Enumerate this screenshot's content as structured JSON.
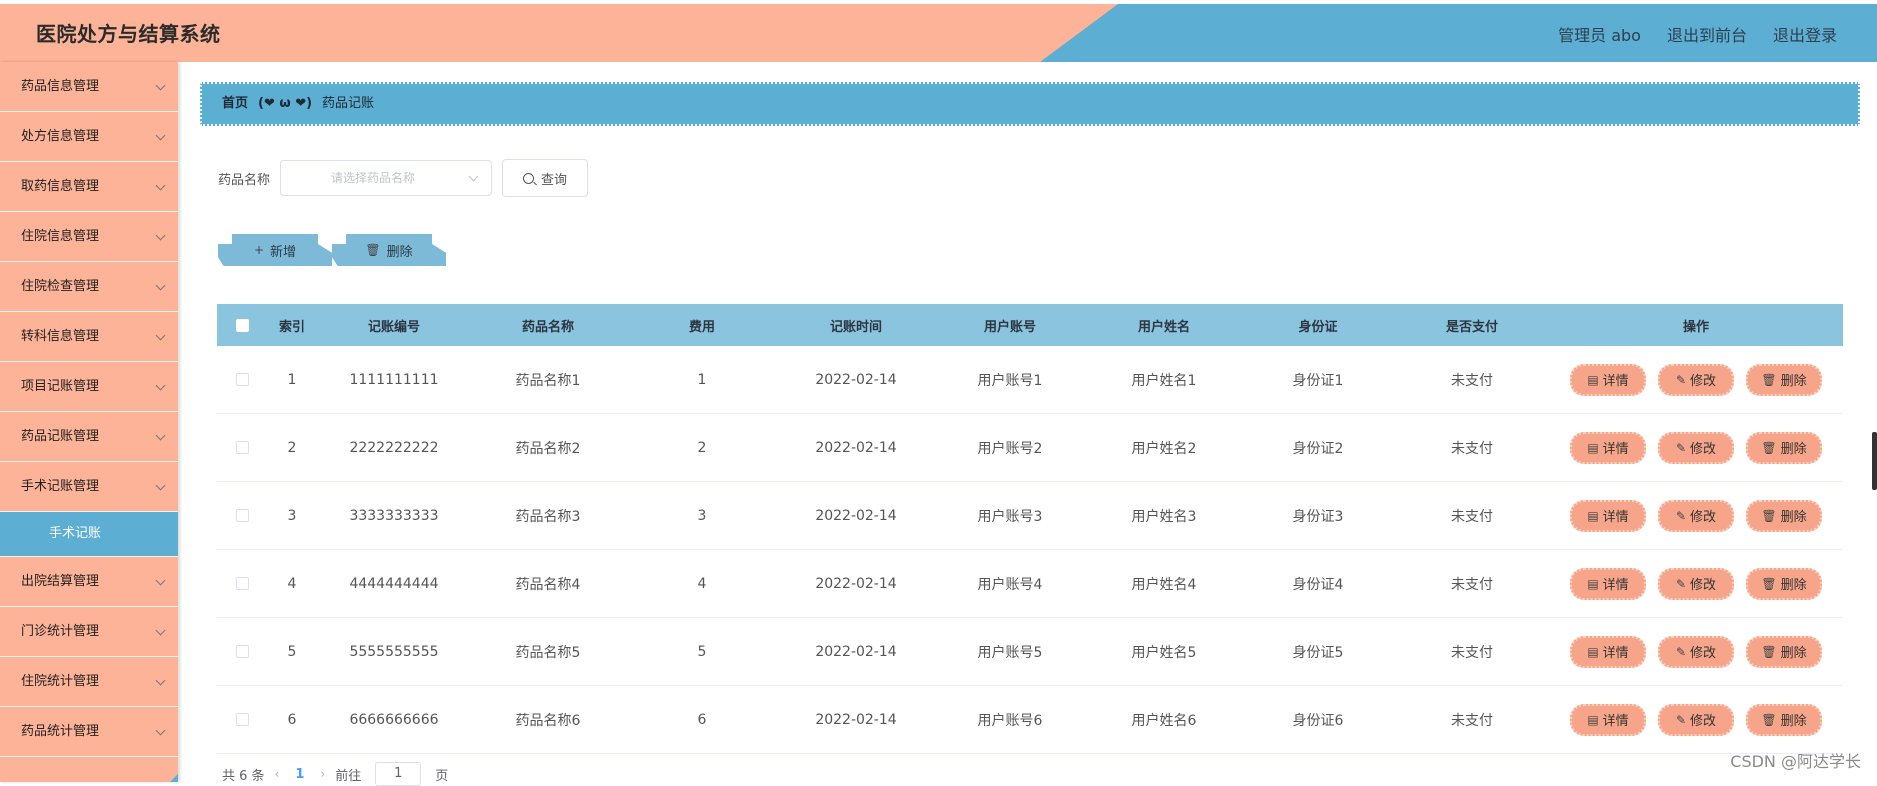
{
  "header": {
    "title": "医院处方与结算系统",
    "user": "管理员 abo",
    "front_link": "退出到前台",
    "logout": "退出登录"
  },
  "sidebar": {
    "items": [
      {
        "label": "药品信息管理"
      },
      {
        "label": "处方信息管理"
      },
      {
        "label": "取药信息管理"
      },
      {
        "label": "住院信息管理"
      },
      {
        "label": "住院检查管理"
      },
      {
        "label": "转科信息管理"
      },
      {
        "label": "项目记账管理"
      },
      {
        "label": "药品记账管理"
      },
      {
        "label": "手术记账管理"
      }
    ],
    "active_sub": "手术记账",
    "items_after": [
      {
        "label": "出院结算管理"
      },
      {
        "label": "门诊统计管理"
      },
      {
        "label": "住院统计管理"
      },
      {
        "label": "药品统计管理"
      }
    ]
  },
  "breadcrumb": {
    "home": "首页",
    "separator": "(❤ ω ❤)",
    "current": "药品记账"
  },
  "search": {
    "label": "药品名称",
    "placeholder": "请选择药品名称",
    "button": "查询"
  },
  "actions": {
    "add": "新增",
    "delete": "删除"
  },
  "table": {
    "headers": {
      "index": "索引",
      "no": "记账编号",
      "name": "药品名称",
      "fee": "费用",
      "time": "记账时间",
      "account": "用户账号",
      "uname": "用户姓名",
      "idcard": "身份证",
      "paid": "是否支付",
      "ops": "操作"
    },
    "rows": [
      {
        "index": "1",
        "no": "1111111111",
        "name": "药品名称1",
        "fee": "1",
        "time": "2022-02-14",
        "account": "用户账号1",
        "uname": "用户姓名1",
        "idcard": "身份证1",
        "paid": "未支付"
      },
      {
        "index": "2",
        "no": "2222222222",
        "name": "药品名称2",
        "fee": "2",
        "time": "2022-02-14",
        "account": "用户账号2",
        "uname": "用户姓名2",
        "idcard": "身份证2",
        "paid": "未支付"
      },
      {
        "index": "3",
        "no": "3333333333",
        "name": "药品名称3",
        "fee": "3",
        "time": "2022-02-14",
        "account": "用户账号3",
        "uname": "用户姓名3",
        "idcard": "身份证3",
        "paid": "未支付"
      },
      {
        "index": "4",
        "no": "4444444444",
        "name": "药品名称4",
        "fee": "4",
        "time": "2022-02-14",
        "account": "用户账号4",
        "uname": "用户姓名4",
        "idcard": "身份证4",
        "paid": "未支付"
      },
      {
        "index": "5",
        "no": "5555555555",
        "name": "药品名称5",
        "fee": "5",
        "time": "2022-02-14",
        "account": "用户账号5",
        "uname": "用户姓名5",
        "idcard": "身份证5",
        "paid": "未支付"
      },
      {
        "index": "6",
        "no": "6666666666",
        "name": "药品名称6",
        "fee": "6",
        "time": "2022-02-14",
        "account": "用户账号6",
        "uname": "用户姓名6",
        "idcard": "身份证6",
        "paid": "未支付"
      }
    ],
    "op_labels": {
      "detail": "详情",
      "edit": "修改",
      "delete": "删除"
    }
  },
  "pager": {
    "total": "共 6 条",
    "current_page": "1",
    "goto_label": "前往",
    "goto_value": "1",
    "page_suffix": "页"
  },
  "watermark": "CSDN @阿达学长",
  "colors": {
    "salmon": "#fdb397",
    "blue": "#5caed2",
    "table_header": "#8bc4df",
    "op_button": "#f6a58a"
  }
}
